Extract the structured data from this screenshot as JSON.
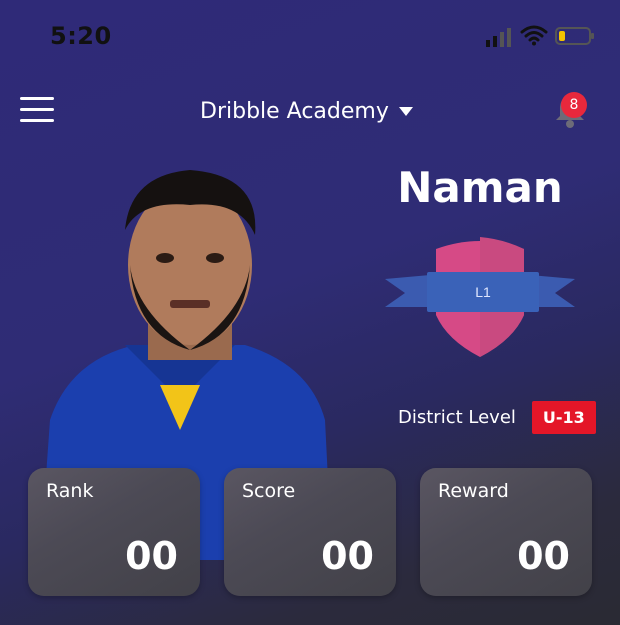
{
  "status_bar": {
    "time": "5:20"
  },
  "header": {
    "academy_name": "Dribble Academy",
    "notification_count": "8"
  },
  "profile": {
    "name": "Naman",
    "level_badge": "L1",
    "level_text": "District Level",
    "age_group": "U-13"
  },
  "stats": [
    {
      "label": "Rank",
      "value": "00"
    },
    {
      "label": "Score",
      "value": "00"
    },
    {
      "label": "Reward",
      "value": "00"
    }
  ],
  "colors": {
    "background_top": "#2f2a78",
    "badge_red": "#e8283c",
    "age_badge_red": "#e41628",
    "shield_pink": "#d64a86",
    "ribbon_blue": "#3b5bb0"
  },
  "icons": {
    "menu": "hamburger-menu-icon",
    "caret": "chevron-down-icon",
    "bell": "bell-icon",
    "signal": "cellular-signal-icon",
    "wifi": "wifi-icon",
    "battery": "battery-icon"
  }
}
